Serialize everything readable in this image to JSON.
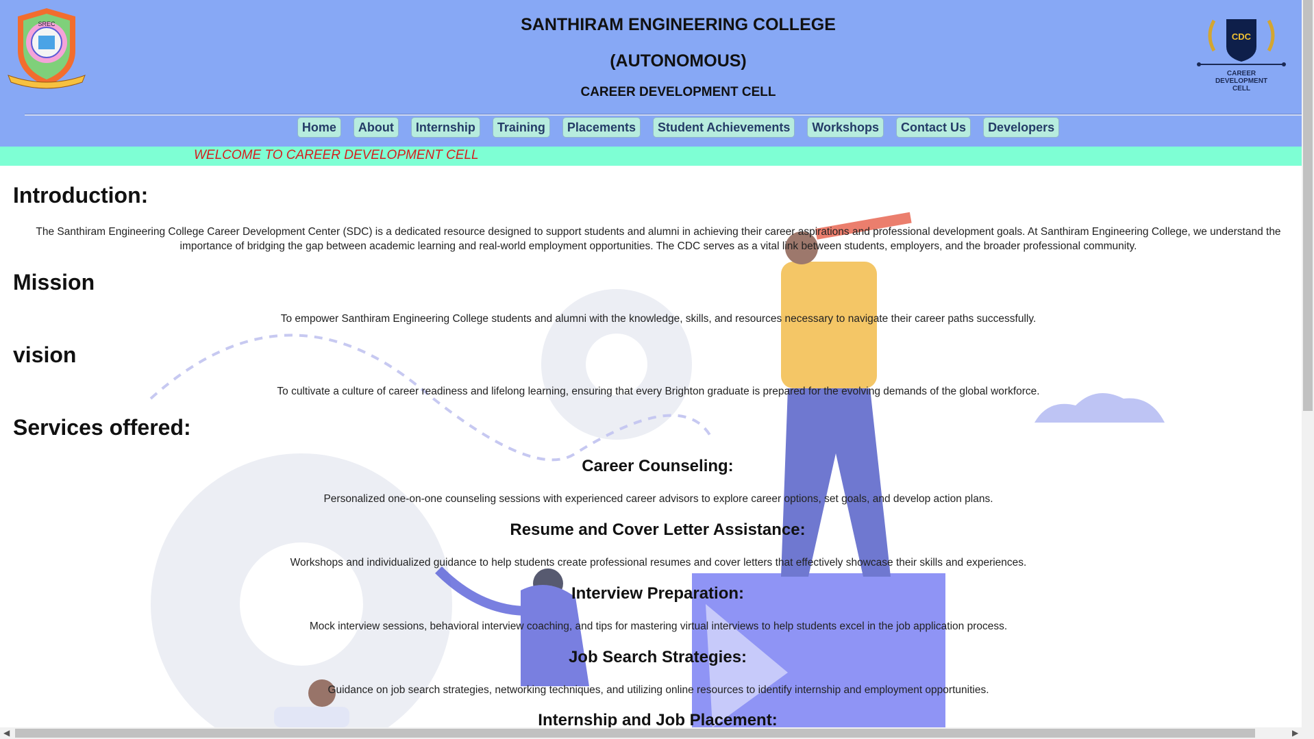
{
  "header": {
    "title_line1": "SANTHIRAM ENGINEERING COLLEGE",
    "title_line2": "(AUTONOMOUS)",
    "title_line3": "CAREER DEVELOPMENT CELL",
    "logo_left_text": "SREC",
    "logo_right_badge": "CDC",
    "logo_right_caption1": "CAREER",
    "logo_right_caption2": "DEVELOPMENT",
    "logo_right_caption3": "CELL"
  },
  "nav": {
    "items": [
      "Home",
      "About",
      "Internship",
      "Training",
      "Placements",
      "Student Achievements",
      "Workshops",
      "Contact Us",
      "Developers"
    ]
  },
  "marquee": {
    "text": "WELCOME TO CAREER DEVELOPMENT CELL"
  },
  "content": {
    "intro_heading": "Introduction:",
    "intro_text": "The Santhiram Engineering College Career Development Center (SDC) is a dedicated resource designed to support students and alumni in achieving their career aspirations and professional development goals. At Santhiram Engineering College, we understand the importance of bridging the gap between academic learning and real-world employment opportunities. The CDC serves as a vital link between students, employers, and the broader professional community.",
    "mission_heading": "Mission",
    "mission_text": "To empower Santhiram Engineering College students and alumni with the knowledge, skills, and resources necessary to navigate their career paths successfully.",
    "vision_heading": "vision",
    "vision_text": "To cultivate a culture of career readiness and lifelong learning, ensuring that every Brighton graduate is prepared for the evolving demands of the global workforce.",
    "services_heading": "Services offered:",
    "services": [
      {
        "title": "Career Counseling:",
        "text": "Personalized one-on-one counseling sessions with experienced career advisors to explore career options, set goals, and develop action plans."
      },
      {
        "title": "Resume and Cover Letter Assistance:",
        "text": "Workshops and individualized guidance to help students create professional resumes and cover letters that effectively showcase their skills and experiences."
      },
      {
        "title": "Interview Preparation:",
        "text": "Mock interview sessions, behavioral interview coaching, and tips for mastering virtual interviews to help students excel in the job application process."
      },
      {
        "title": "Job Search Strategies:",
        "text": "Guidance on job search strategies, networking techniques, and utilizing online resources to identify internship and employment opportunities."
      },
      {
        "title": "Internship and Job Placement:",
        "text": ""
      }
    ]
  },
  "colors": {
    "header_bg": "#87a8f5",
    "marquee_bg": "#7effd4",
    "marquee_text": "#d51f1f",
    "nav_button_bg": "#b7ecde"
  }
}
